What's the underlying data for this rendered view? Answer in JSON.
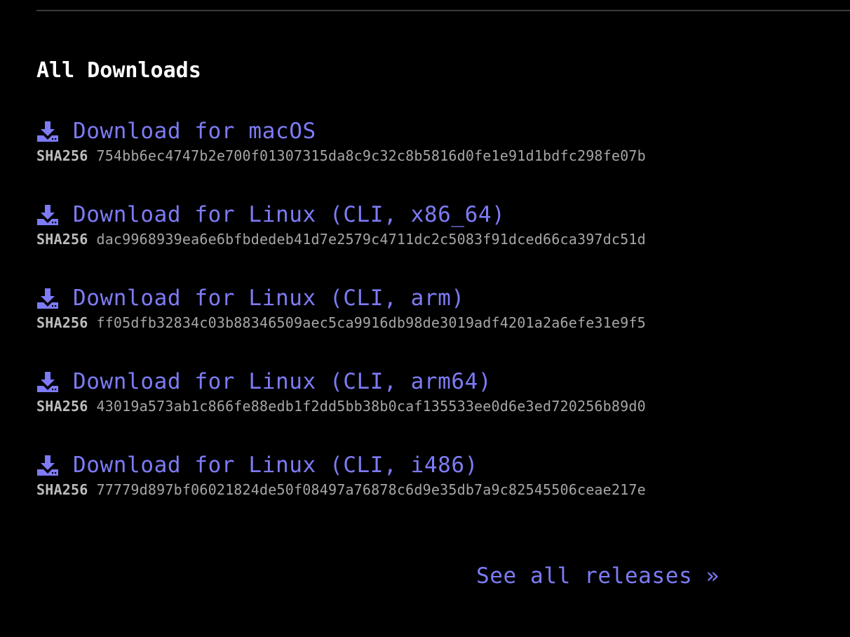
{
  "section": {
    "title": "All Downloads"
  },
  "downloads": [
    {
      "label": "Download for macOS",
      "hash_label": "SHA256",
      "hash": "754bb6ec4747b2e700f01307315da8c9c32c8b5816d0fe1e91d1bdfc298fe07b"
    },
    {
      "label": "Download for Linux (CLI, x86_64)",
      "hash_label": "SHA256",
      "hash": "dac9968939ea6e6bfbdedeb41d7e2579c4711dc2c5083f91dced66ca397dc51d"
    },
    {
      "label": "Download for Linux (CLI, arm)",
      "hash_label": "SHA256",
      "hash": "ff05dfb32834c03b88346509aec5ca9916db98de3019adf4201a2a6efe31e9f5"
    },
    {
      "label": "Download for Linux (CLI, arm64)",
      "hash_label": "SHA256",
      "hash": "43019a573ab1c866fe88edb1f2dd5bb38b0caf135533ee0d6e3ed720256b89d0"
    },
    {
      "label": "Download for Linux (CLI, i486)",
      "hash_label": "SHA256",
      "hash": "77779d897bf06021824de50f08497a76878c6d9e35db7a9c82545506ceae217e"
    }
  ],
  "footer": {
    "releases_link": "See all releases »"
  },
  "icons": {
    "download": "download-icon"
  },
  "colors": {
    "background": "#000000",
    "link": "#7d7bf5",
    "heading": "#ffffff",
    "hash_text": "#a6a6a6"
  }
}
